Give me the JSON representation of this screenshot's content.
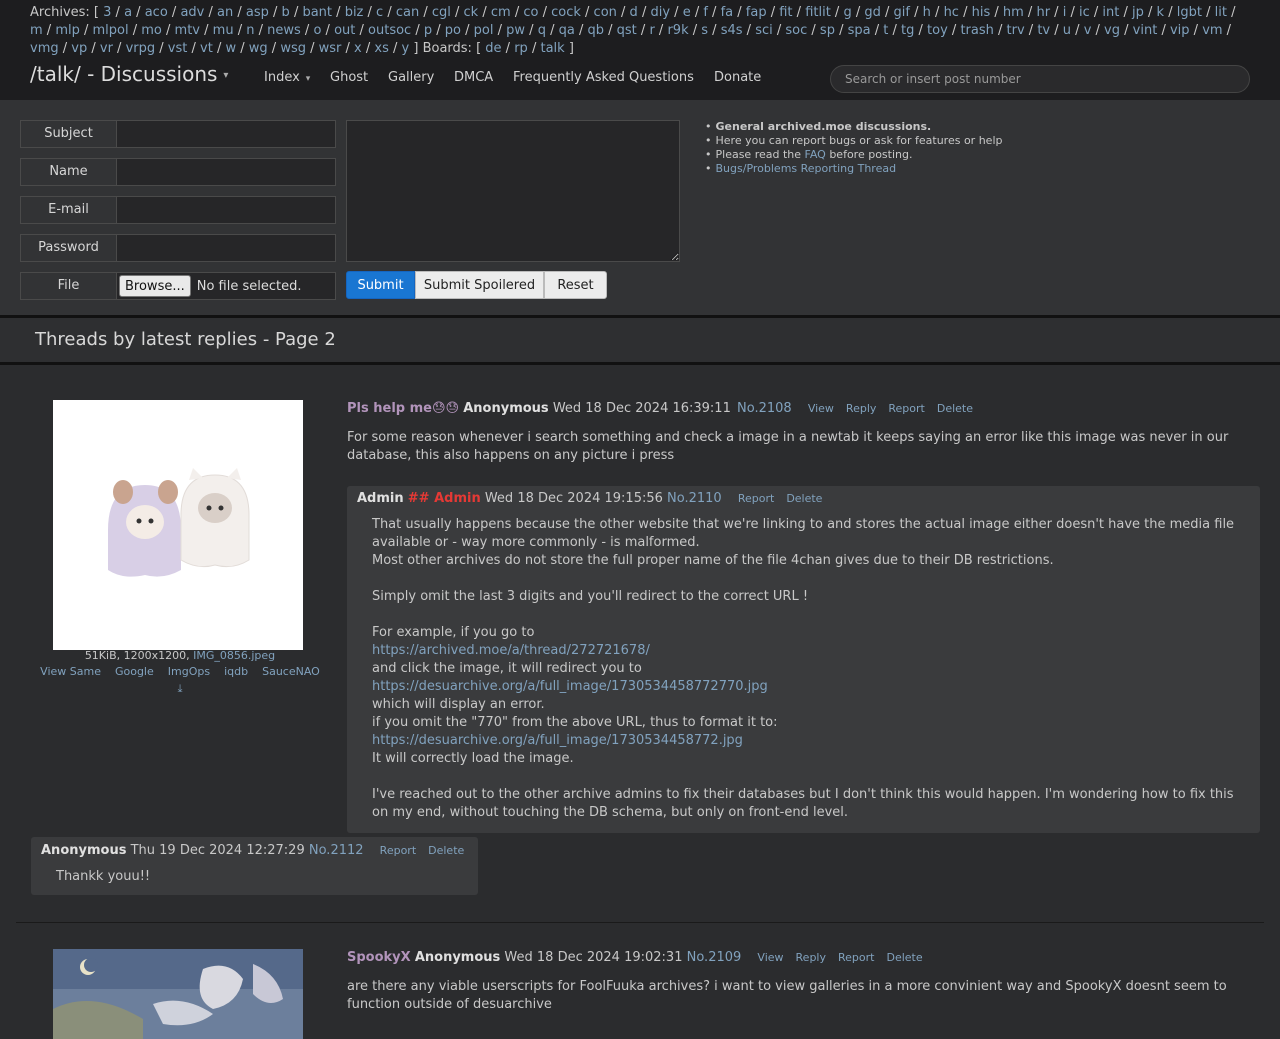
{
  "top": {
    "archives_prefix": "Archives: [",
    "archives": [
      "3",
      "a",
      "aco",
      "adv",
      "an",
      "asp",
      "b",
      "bant",
      "biz",
      "c",
      "can",
      "cgl",
      "ck",
      "cm",
      "co",
      "cock",
      "con",
      "d",
      "diy",
      "e",
      "f",
      "fa",
      "fap",
      "fit",
      "fitlit",
      "g",
      "gd",
      "gif",
      "h",
      "hc",
      "his",
      "hm",
      "hr",
      "i",
      "ic",
      "int",
      "jp",
      "k",
      "lgbt",
      "lit",
      "m",
      "mlp",
      "mlpol",
      "mo",
      "mtv",
      "mu",
      "n",
      "news",
      "o",
      "out",
      "outsoc",
      "p",
      "po",
      "pol",
      "pw",
      "q",
      "qa",
      "qb",
      "qst",
      "r",
      "r9k",
      "s",
      "s4s",
      "sci",
      "soc",
      "sp",
      "spa",
      "t",
      "tg",
      "toy",
      "trash",
      "trv",
      "tv",
      "u",
      "v",
      "vg",
      "vint",
      "vip",
      "vm",
      "vmg",
      "vp",
      "vr",
      "vrpg",
      "vst",
      "vt",
      "w",
      "wg",
      "wsg",
      "wsr",
      "x",
      "xs",
      "y"
    ],
    "boards_prefix": "] Boards: [",
    "boards": [
      "de",
      "rp",
      "talk"
    ],
    "suffix": "]"
  },
  "nav": {
    "title": "/talk/ - Discussions",
    "caret": "▾",
    "index": "Index",
    "ghost": "Ghost",
    "gallery": "Gallery",
    "dmca": "DMCA",
    "faq": "Frequently Asked Questions",
    "donate": "Donate",
    "search_placeholder": "Search or insert post number"
  },
  "form": {
    "subject_label": "Subject",
    "name_label": "Name",
    "email_label": "E-mail",
    "password_label": "Password",
    "file_label": "File",
    "browse_label": "Browse...",
    "no_file": "No file selected.",
    "submit": "Submit",
    "submit_spoilered": "Submit Spoilered",
    "reset": "Reset"
  },
  "info": {
    "line1": "General archived.moe discussions.",
    "line2": "Here you can report bugs or ask for features or help",
    "line3_a": "Please read the ",
    "line3_link": "FAQ",
    "line3_b": " before posting.",
    "line4": "Bugs/Problems Reporting Thread",
    "bullet": "•"
  },
  "heading": "Threads by latest replies - Page 2",
  "threads": [
    {
      "fileinfo": "51KiB, 1200x1200,",
      "filename": "IMG_0856.jpeg",
      "search_links": [
        "View Same",
        "Google",
        "ImgOps",
        "iqdb",
        "SauceNAO"
      ],
      "download_icon": "⤓",
      "subject": "Pls help me😓😓",
      "name": "Anonymous",
      "date": "Wed 18 Dec 2024 16:39:11",
      "no": "No.2108",
      "actions": [
        "View",
        "Reply",
        "Report",
        "Delete"
      ],
      "body": [
        "For some reason whenever i search something and check a image in a newtab it keeps saying an error like this image was never in our",
        "database, this also happens on any picture i press"
      ],
      "replies": [
        {
          "name": "Admin",
          "capcode": "## Admin",
          "date": "Wed 18 Dec 2024 19:15:56",
          "no": "No.2110",
          "actions": [
            "Report",
            "Delete"
          ],
          "lines": [
            "That usually happens because the other website that we're linking to and stores the actual image either doesn't have the media file",
            "available or - way more commonly - is malformed.",
            "Most other archives do not store the full proper name of the file 4chan gives due to their DB restrictions.",
            "",
            "Simply omit the last 3 digits and you'll redirect to the correct URL !",
            "",
            "For example, if you go to",
            "https://archived.moe/a/thread/272721678/",
            "and click the image, it will redirect you to",
            "https://desuarchive.org/a/full_image/1730534458772770.jpg",
            "which will display an error.",
            "if you omit the \"770\" from the above URL, thus to format it to:",
            "https://desuarchive.org/a/full_image/1730534458772.jpg",
            "It will correctly load the image.",
            "",
            "I've reached out to the other archive admins to fix their databases but I don't think this would happen. I'm wondering how to fix this",
            "on my end, without touching the DB schema, but only on front-end level."
          ]
        },
        {
          "name": "Anonymous",
          "date": "Thu 19 Dec 2024 12:27:29",
          "no": "No.2112",
          "actions": [
            "Report",
            "Delete"
          ],
          "lines": [
            "Thankk youu!!"
          ]
        }
      ]
    },
    {
      "subject": "SpookyX",
      "name": "Anonymous",
      "date": "Wed 18 Dec 2024 19:02:31",
      "no": "No.2109",
      "actions": [
        "View",
        "Reply",
        "Report",
        "Delete"
      ],
      "body": [
        "are there any viable userscripts for FoolFuuka archives? i want to view galleries in a more convinient way and SpookyX doesnt seem to",
        "function outside of desuarchive"
      ]
    }
  ]
}
